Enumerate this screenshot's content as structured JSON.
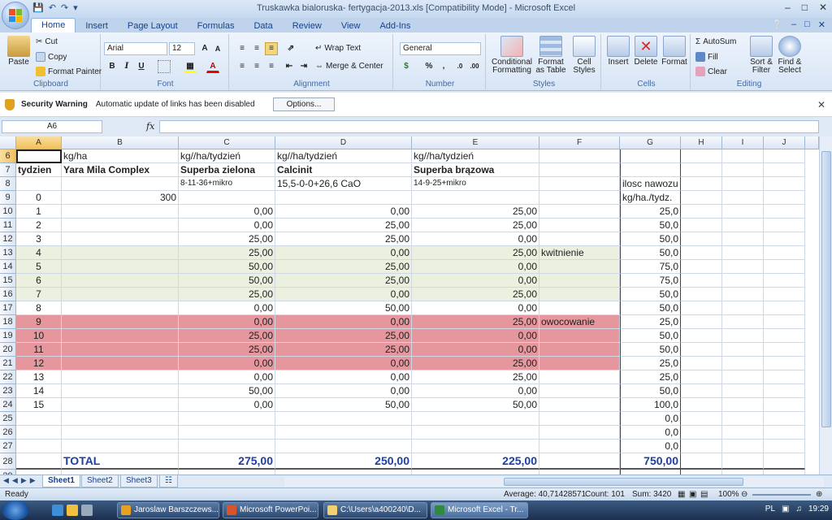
{
  "window": {
    "title": "Truskawka bialoruska- fertygacja-2013.xls  [Compatibility Mode] - Microsoft Excel",
    "qat": [
      "save-icon",
      "undo-icon",
      "redo-icon",
      "customize-icon"
    ]
  },
  "tabs": [
    "Home",
    "Insert",
    "Page Layout",
    "Formulas",
    "Data",
    "Review",
    "View",
    "Add-Ins"
  ],
  "ribbon": {
    "clipboard": {
      "label": "Clipboard",
      "paste": "Paste",
      "cut": "Cut",
      "copy": "Copy",
      "format_painter": "Format Painter"
    },
    "font": {
      "label": "Font",
      "font_name": "Arial",
      "font_size": "12",
      "bold": "B",
      "italic": "I",
      "underline": "U"
    },
    "alignment": {
      "label": "Alignment",
      "wrap_text": "Wrap Text",
      "merge_center": "Merge & Center"
    },
    "number": {
      "label": "Number",
      "format": "General",
      "percent": "%",
      "comma": ","
    },
    "styles": {
      "label": "Styles",
      "conditional": "Conditional Formatting",
      "format_table": "Format as Table",
      "cell_styles": "Cell Styles"
    },
    "cells": {
      "label": "Cells",
      "insert": "Insert",
      "delete": "Delete",
      "format": "Format"
    },
    "editing": {
      "label": "Editing",
      "autosum": "AutoSum",
      "fill": "Fill",
      "clear": "Clear",
      "sort_filter": "Sort & Filter",
      "find_select": "Find & Select"
    }
  },
  "security": {
    "title": "Security Warning",
    "message": "Automatic update of links has been disabled",
    "options_button": "Options..."
  },
  "formula_bar": {
    "name_box": "A6",
    "fx": "fx",
    "value": ""
  },
  "columns": [
    "A",
    "B",
    "C",
    "D",
    "E",
    "F",
    "G",
    "H",
    "I",
    "J"
  ],
  "rows": [
    {
      "num": "6",
      "cells": [
        "",
        "kg/ha",
        "kg//ha/tydzień",
        "kg//ha/tydzień",
        "kg//ha/tydzień",
        "",
        "",
        "",
        "",
        ""
      ]
    },
    {
      "num": "7",
      "cells": [
        "tydzien",
        "Yara Mila Complex",
        "Superba zielona",
        "Calcinit",
        "Superba brązowa",
        "",
        "",
        "",
        "",
        ""
      ]
    },
    {
      "num": "8",
      "cells": [
        "",
        "",
        "8-11-36+mikro",
        "15,5-0-0+26,6 CaO",
        "14-9-25+mikro",
        "",
        "ilosc nawozu",
        "",
        "",
        ""
      ]
    },
    {
      "num": "9",
      "cells": [
        "0",
        "300",
        "",
        "",
        "",
        "",
        "kg/ha./tydz.",
        "",
        "",
        ""
      ]
    },
    {
      "num": "10",
      "cells": [
        "1",
        "",
        "0,00",
        "0,00",
        "25,00",
        "",
        "25,0",
        "",
        "",
        ""
      ]
    },
    {
      "num": "11",
      "cells": [
        "2",
        "",
        "0,00",
        "25,00",
        "25,00",
        "",
        "50,0",
        "",
        "",
        ""
      ]
    },
    {
      "num": "12",
      "cells": [
        "3",
        "",
        "25,00",
        "25,00",
        "0,00",
        "",
        "50,0",
        "",
        "",
        ""
      ]
    },
    {
      "num": "13",
      "cells": [
        "4",
        "",
        "25,00",
        "0,00",
        "25,00",
        "kwitnienie",
        "50,0",
        "",
        "",
        ""
      ]
    },
    {
      "num": "14",
      "cells": [
        "5",
        "",
        "50,00",
        "25,00",
        "0,00",
        "",
        "75,0",
        "",
        "",
        ""
      ]
    },
    {
      "num": "15",
      "cells": [
        "6",
        "",
        "50,00",
        "25,00",
        "0,00",
        "",
        "75,0",
        "",
        "",
        ""
      ]
    },
    {
      "num": "16",
      "cells": [
        "7",
        "",
        "25,00",
        "0,00",
        "25,00",
        "",
        "50,0",
        "",
        "",
        ""
      ]
    },
    {
      "num": "17",
      "cells": [
        "8",
        "",
        "0,00",
        "50,00",
        "0,00",
        "",
        "50,0",
        "",
        "",
        ""
      ]
    },
    {
      "num": "18",
      "cells": [
        "9",
        "",
        "0,00",
        "0,00",
        "25,00",
        "owocowanie",
        "25,0",
        "",
        "",
        ""
      ]
    },
    {
      "num": "19",
      "cells": [
        "10",
        "",
        "25,00",
        "25,00",
        "0,00",
        "",
        "50,0",
        "",
        "",
        ""
      ]
    },
    {
      "num": "20",
      "cells": [
        "11",
        "",
        "25,00",
        "25,00",
        "0,00",
        "",
        "50,0",
        "",
        "",
        ""
      ]
    },
    {
      "num": "21",
      "cells": [
        "12",
        "",
        "0,00",
        "0,00",
        "25,00",
        "",
        "25,0",
        "",
        "",
        ""
      ]
    },
    {
      "num": "22",
      "cells": [
        "13",
        "",
        "0,00",
        "0,00",
        "25,00",
        "",
        "25,0",
        "",
        "",
        ""
      ]
    },
    {
      "num": "23",
      "cells": [
        "14",
        "",
        "50,00",
        "0,00",
        "0,00",
        "",
        "50,0",
        "",
        "",
        ""
      ]
    },
    {
      "num": "24",
      "cells": [
        "15",
        "",
        "0,00",
        "50,00",
        "50,00",
        "",
        "100,0",
        "",
        "",
        ""
      ]
    },
    {
      "num": "25",
      "cells": [
        "",
        "",
        "",
        "",
        "",
        "",
        "0,0",
        "",
        "",
        ""
      ]
    },
    {
      "num": "26",
      "cells": [
        "",
        "",
        "",
        "",
        "",
        "",
        "0,0",
        "",
        "",
        ""
      ]
    },
    {
      "num": "27",
      "cells": [
        "",
        "",
        "",
        "",
        "",
        "",
        "0,0",
        "",
        "",
        ""
      ]
    },
    {
      "num": "28",
      "cells": [
        "",
        "TOTAL",
        "275,00",
        "250,00",
        "225,00",
        "",
        "750,00",
        "",
        "",
        ""
      ]
    },
    {
      "num": "29",
      "cells": [
        "",
        "",
        "",
        "",
        "",
        "",
        "",
        "",
        "",
        ""
      ]
    }
  ],
  "row_fills": {
    "13": "#ebf1de",
    "14": "#ebf1de",
    "15": "#ebf1de",
    "16": "#ebf1de",
    "18": "#e6969d",
    "19": "#e6969d",
    "20": "#e6969d",
    "21": "#e6969d"
  },
  "sheets": [
    "Sheet1",
    "Sheet2",
    "Sheet3"
  ],
  "status": {
    "ready": "Ready",
    "average": "Average: 40,71428571",
    "count": "Count: 101",
    "sum": "Sum: 3420",
    "zoom": "100%"
  },
  "taskbar": {
    "items": [
      "Jaroslaw Barszczews...",
      "Microsoft PowerPoi...",
      "C:\\Users\\a400240\\D...",
      "Microsoft Excel - Tr..."
    ],
    "lang": "PL",
    "time": "19:29"
  }
}
